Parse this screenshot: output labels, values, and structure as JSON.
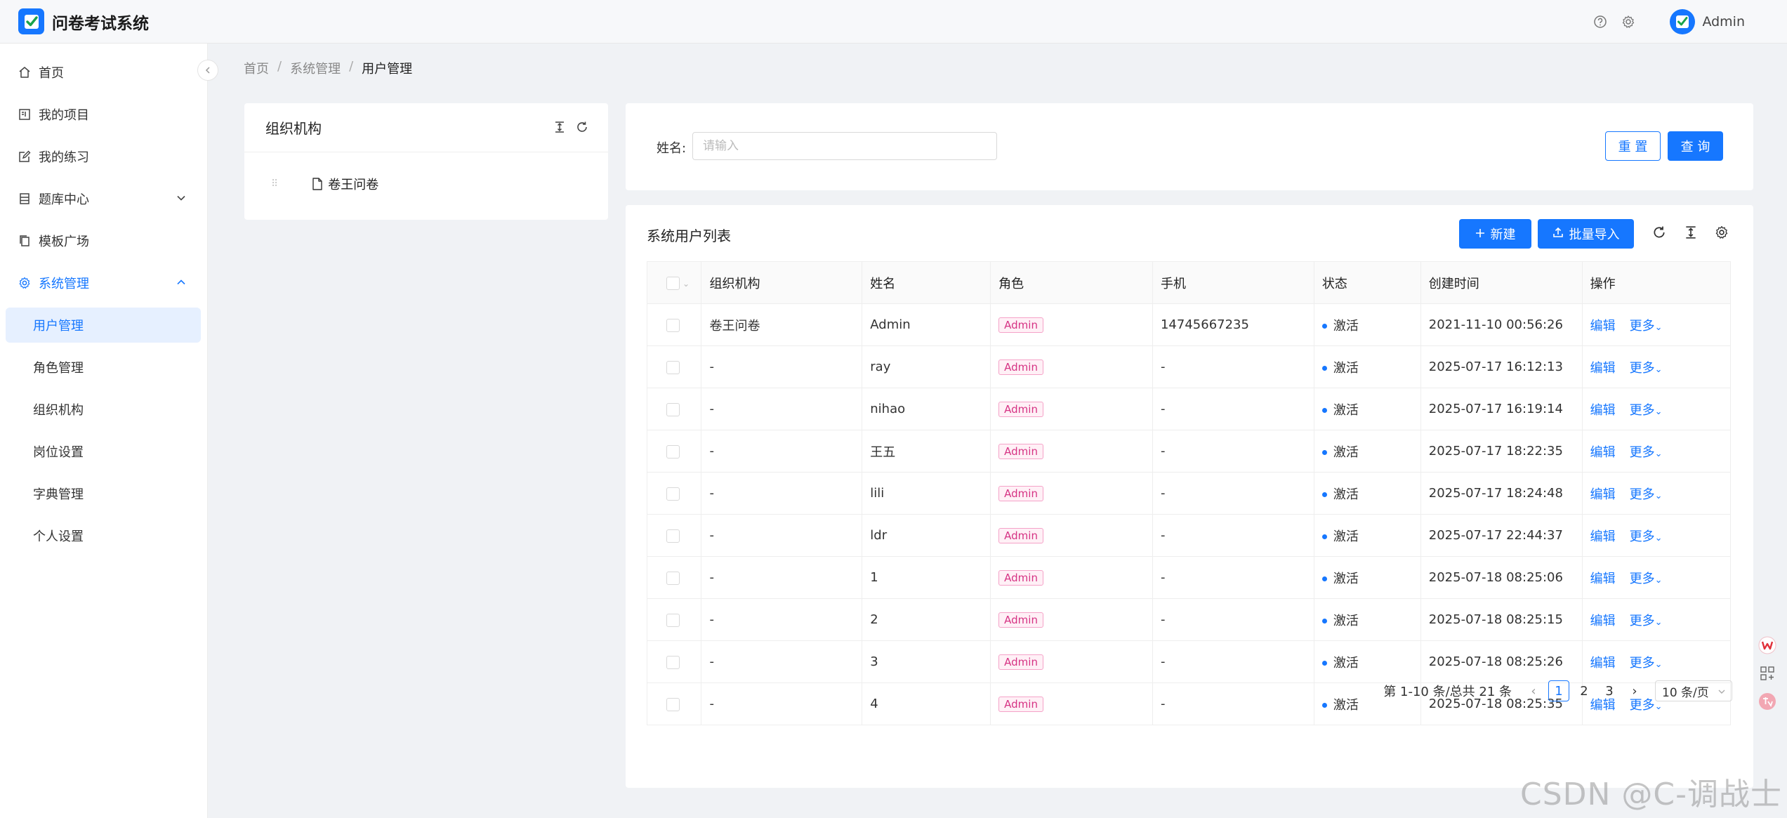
{
  "app": {
    "title": "问卷考试系统",
    "user": "Admin"
  },
  "sidebar": {
    "items": [
      {
        "label": "首页"
      },
      {
        "label": "我的项目"
      },
      {
        "label": "我的练习"
      },
      {
        "label": "题库中心"
      },
      {
        "label": "模板广场"
      },
      {
        "label": "系统管理"
      }
    ],
    "sub_items": [
      {
        "label": "用户管理"
      },
      {
        "label": "角色管理"
      },
      {
        "label": "组织机构"
      },
      {
        "label": "岗位设置"
      },
      {
        "label": "字典管理"
      },
      {
        "label": "个人设置"
      }
    ]
  },
  "breadcrumb": {
    "items": [
      "首页",
      "系统管理",
      "用户管理"
    ],
    "separator": "/"
  },
  "org_panel": {
    "title": "组织机构",
    "tree": [
      {
        "label": "卷王问卷"
      }
    ]
  },
  "search": {
    "label": "姓名:",
    "placeholder": "请输入",
    "value": "",
    "reset_label": "重 置",
    "query_label": "查 询"
  },
  "list": {
    "title": "系统用户列表",
    "new_label": "新建",
    "import_label": "批量导入",
    "columns": [
      "组织机构",
      "姓名",
      "角色",
      "手机",
      "状态",
      "创建时间",
      "操作"
    ],
    "rows": [
      {
        "org": "卷王问卷",
        "name": "Admin",
        "role": "Admin",
        "phone": "14745667235",
        "status": "激活",
        "created": "2021-11-10 00:56:26",
        "edit": "编辑",
        "more": "更多"
      },
      {
        "org": "-",
        "name": "ray",
        "role": "Admin",
        "phone": "-",
        "status": "激活",
        "created": "2025-07-17 16:12:13",
        "edit": "编辑",
        "more": "更多"
      },
      {
        "org": "-",
        "name": "nihao",
        "role": "Admin",
        "phone": "-",
        "status": "激活",
        "created": "2025-07-17 16:19:14",
        "edit": "编辑",
        "more": "更多"
      },
      {
        "org": "-",
        "name": "王五",
        "role": "Admin",
        "phone": "-",
        "status": "激活",
        "created": "2025-07-17 18:22:35",
        "edit": "编辑",
        "more": "更多"
      },
      {
        "org": "-",
        "name": "lili",
        "role": "Admin",
        "phone": "-",
        "status": "激活",
        "created": "2025-07-17 18:24:48",
        "edit": "编辑",
        "more": "更多"
      },
      {
        "org": "-",
        "name": "ldr",
        "role": "Admin",
        "phone": "-",
        "status": "激活",
        "created": "2025-07-17 22:44:37",
        "edit": "编辑",
        "more": "更多"
      },
      {
        "org": "-",
        "name": "1",
        "role": "Admin",
        "phone": "-",
        "status": "激活",
        "created": "2025-07-18 08:25:06",
        "edit": "编辑",
        "more": "更多"
      },
      {
        "org": "-",
        "name": "2",
        "role": "Admin",
        "phone": "-",
        "status": "激活",
        "created": "2025-07-18 08:25:15",
        "edit": "编辑",
        "more": "更多"
      },
      {
        "org": "-",
        "name": "3",
        "role": "Admin",
        "phone": "-",
        "status": "激活",
        "created": "2025-07-18 08:25:26",
        "edit": "编辑",
        "more": "更多"
      },
      {
        "org": "-",
        "name": "4",
        "role": "Admin",
        "phone": "-",
        "status": "激活",
        "created": "2025-07-18 08:25:35",
        "edit": "编辑",
        "more": "更多"
      }
    ]
  },
  "pagination": {
    "summary": "第 1-10 条/总共 21 条",
    "pages": [
      "1",
      "2",
      "3"
    ],
    "current": "1",
    "page_size": "10 条/页"
  },
  "watermark": "CSDN @C-调战士",
  "colors": {
    "primary": "#1677ff",
    "tag_text": "#d63384",
    "tag_bg": "#fff0f6",
    "bg": "#f0f2f5"
  }
}
